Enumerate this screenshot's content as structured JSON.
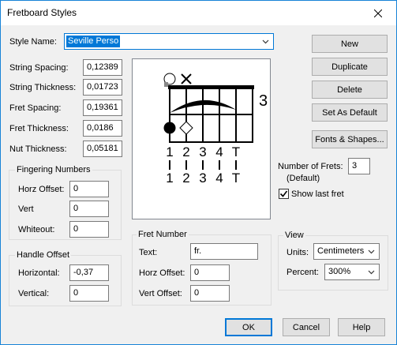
{
  "window": {
    "title": "Fretboard Styles"
  },
  "style_name": {
    "label": "Style Name:",
    "value": "Seville Perso"
  },
  "fields": [
    {
      "label": "String Spacing:",
      "value": "0,12389"
    },
    {
      "label": "String Thickness:",
      "value": "0,01723"
    },
    {
      "label": "Fret Spacing:",
      "value": "0,19361"
    },
    {
      "label": "Fret Thickness:",
      "value": "0,0186"
    },
    {
      "label": "Nut Thickness:",
      "value": "0,05181"
    }
  ],
  "fingering": {
    "title": "Fingering Numbers",
    "horz_label": "Horz Offset:",
    "horz_value": "0",
    "vert_label": "Vert",
    "vert_value": "0",
    "whiteout_label": "Whiteout:",
    "whiteout_value": "0"
  },
  "handle": {
    "title": "Handle Offset",
    "horizontal_label": "Horizontal:",
    "horizontal_value": "-0,37",
    "vertical_label": "Vertical:",
    "vertical_value": "0"
  },
  "fret_number": {
    "title": "Fret Number",
    "text_label": "Text:",
    "text_value": "fr.",
    "horz_label": "Horz Offset:",
    "horz_value": "0",
    "vert_label": "Vert Offset:",
    "vert_value": "0"
  },
  "preview": {
    "fret_label": "3",
    "fingers_top": [
      "1",
      "2",
      "3",
      "4",
      "T"
    ],
    "fingers_bottom": [
      "1",
      "2",
      "3",
      "4",
      "T"
    ]
  },
  "buttons": {
    "new": "New",
    "duplicate": "Duplicate",
    "delete": "Delete",
    "set_default": "Set As Default",
    "fonts": "Fonts & Shapes...",
    "ok": "OK",
    "cancel": "Cancel",
    "help": "Help"
  },
  "frets": {
    "label": "Number of Frets:",
    "default_label": "(Default)",
    "value": "3"
  },
  "show_last_fret": {
    "label": "Show last fret",
    "checked": true
  },
  "view": {
    "title": "View",
    "units_label": "Units:",
    "units_value": "Centimeters",
    "percent_label": "Percent:",
    "percent_value": "300%"
  },
  "colors": {
    "accent": "#0078d7",
    "border": "#1883d7"
  }
}
